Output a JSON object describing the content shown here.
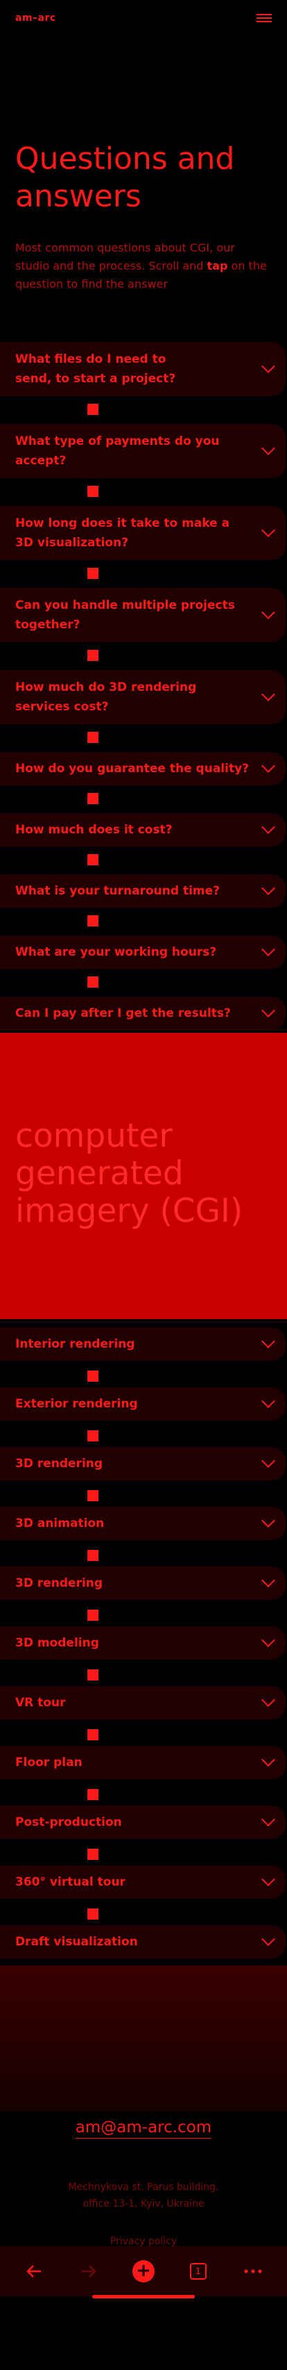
{
  "header": {
    "logo": "am–arc"
  },
  "hero": {
    "title": "Questions and answers",
    "intro_pre": "Most common questions about CGI, our studio and the process. Scroll and ",
    "intro_bold": "tap",
    "intro_post": " on the question to find the answer"
  },
  "faq": [
    "What files do I need to send, to start a project?",
    "What type of payments do you accept?",
    "How long does it take to make a 3D visualization?",
    "Can you handle multiple projects together?",
    "How much do 3D rendering services cost?",
    "How do you guarantee the quality?",
    "How much does it cost?",
    "What is your turnaround time?",
    "What are your working hours?",
    "Can I pay after I get the results?"
  ],
  "cgi": {
    "title": "computer generated imagery (CGI)"
  },
  "services": [
    "Interior rendering",
    "Exterior rendering",
    "3D rendering",
    "3D animation",
    "3D rendering",
    "3D modeling",
    "VR tour",
    "Floor plan",
    "Post-production",
    "360° virtual tour",
    "Draft visualization"
  ],
  "footer": {
    "email": "am@am-arc.com",
    "address_line1": "Mechnykova st. Parus building,",
    "address_line2": "office 13-1, Kyiv, Ukraine",
    "privacy": "Privacy policy",
    "socials": [
      "upwork-icon",
      "mail-icon",
      "whatsapp-icon",
      "behance-icon",
      "instagram-icon",
      "telegram-icon"
    ]
  },
  "browser": {
    "icons": [
      "back-icon",
      "forward-icon",
      "new-tab-icon",
      "tabs-icon",
      "more-icon"
    ],
    "tab_count": "1"
  },
  "colors": {
    "accent": "#ff1a1a",
    "dark": "#200000",
    "banner": "#c80000"
  }
}
